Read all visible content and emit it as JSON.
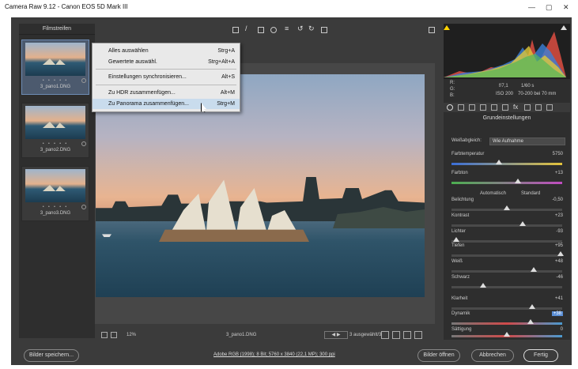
{
  "window": {
    "title": "Camera Raw 9.12 - Canon EOS 5D Mark III"
  },
  "filmstrip": {
    "label": "Filmstreifen",
    "items": [
      {
        "name": "3_pano1.DNG"
      },
      {
        "name": "3_pano2.DNG"
      },
      {
        "name": "3_pano3.DNG"
      }
    ]
  },
  "menu": {
    "items": [
      {
        "label": "Alles auswählen",
        "shortcut": "Strg+A"
      },
      {
        "label": "Gewertete auswähl.",
        "shortcut": "Strg+Alt+A"
      },
      {
        "label": "Einstellungen synchronisieren...",
        "shortcut": "Alt+S"
      },
      {
        "label": "Zu HDR zusammenfügen...",
        "shortcut": "Alt+M"
      },
      {
        "label": "Zu Panorama zusammenfügen...",
        "shortcut": "Strg+M"
      }
    ]
  },
  "status": {
    "zoom": "12%",
    "filename": "3_pano1.DNG",
    "selection": "3 ausgewählt/3"
  },
  "camera": {
    "r": "R:",
    "g": "G:",
    "b": "B:",
    "aperture": "f/7,1",
    "shutter": "1/60 s",
    "iso": "ISO 200",
    "lens": "70-200 bei 70 mm"
  },
  "panel": {
    "title": "Grundeinstellungen",
    "wb_label": "Weißabgleich:",
    "wb_value": "Wie Aufnahme",
    "auto": "Automatisch",
    "standard": "Standard",
    "sliders": [
      {
        "label": "Farbtemperatur",
        "value": "5750"
      },
      {
        "label": "Farbton",
        "value": "+13"
      },
      {
        "label": "Belichtung",
        "value": "-0,50"
      },
      {
        "label": "Kontrast",
        "value": "+23"
      },
      {
        "label": "Lichter",
        "value": "-93"
      },
      {
        "label": "Tiefen",
        "value": "+95"
      },
      {
        "label": "Weiß",
        "value": "+48"
      },
      {
        "label": "Schwarz",
        "value": "-46"
      },
      {
        "label": "Klarheit",
        "value": "+41"
      },
      {
        "label": "Dynamik",
        "value": "+38"
      },
      {
        "label": "Sättigung",
        "value": "0"
      }
    ]
  },
  "footer": {
    "save": "Bilder speichern...",
    "info": "Adobe RGB (1998); 8 Bit; 5760 x 3840 (22,1 MP); 300 ppi",
    "open": "Bilder öffnen",
    "cancel": "Abbrechen",
    "done": "Fertig"
  }
}
